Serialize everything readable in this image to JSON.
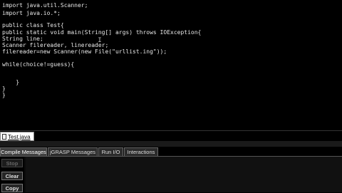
{
  "editor": {
    "lines": [
      "import java.util.Scanner;",
      "import java.io.*;",
      "",
      "public class Test{",
      "public static void main(String[] args) throws IOException{",
      "String line;",
      "Scanner filereader, linereader;",
      "filereader=new Scanner(new File(\"urllist.ing\"));",
      "",
      "while(choice!=guess){",
      "",
      "",
      "    }",
      "}",
      "}"
    ],
    "mouse_cursor": "text-ibeam-cursor"
  },
  "file_tab": {
    "label": "Test.java *",
    "icon": "document-icon"
  },
  "message_tabs": [
    {
      "label": "Compile Messages",
      "active": true
    },
    {
      "label": "jGRASP Messages",
      "active": false
    },
    {
      "label": "Run I/O",
      "active": false
    },
    {
      "label": "Interactions",
      "active": false
    }
  ],
  "buttons": {
    "stop": "Stop",
    "clear": "Clear",
    "copy": "Copy"
  }
}
